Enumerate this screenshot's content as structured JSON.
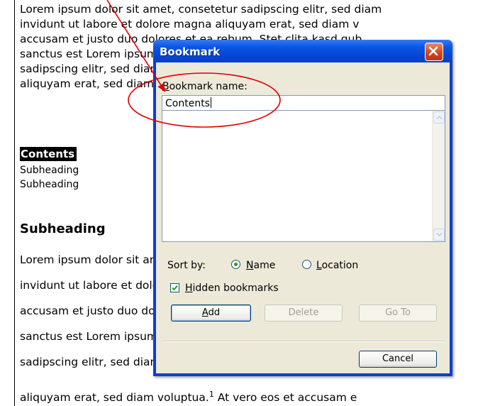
{
  "document": {
    "lines_top": [
      "Lorem ipsum dolor sit amet, consetetur sadipscing elitr, sed diam",
      "invidunt ut labore et dolore magna aliquyam erat, sed diam v",
      "accusam et justo duo dolores et ea rebum. Stet clita kasd gub",
      "sanctus est Lorem ipsum dolor sit amet. Lorem ipsum dolor s",
      "sadipscing elitr, sed diam nonumy eirmod tempor invidunt ut",
      "aliquyam erat, sed diam voluptua."
    ],
    "contents_heading": "Contents",
    "toc_items": [
      "Subheading",
      "Subheading"
    ],
    "subheading": "Subheading",
    "lines_bottom": [
      "Lorem ipsum dolor sit amet, consetetur sadipscing elitr, sed d",
      "invidunt ut labore et dolore magna aliquyam erat, sed diam v",
      "accusam et justo duo dolores et ea rebum. Stet clita kasd gub",
      "sanctus est Lorem ipsum dolor sit amet. Lorem ipsum dolor s",
      "sadipscing elitr, sed diam nonumy eirmod tempor invidunt ut",
      "aliquyam erat, sed diam voluptua."
    ],
    "last_line_rest": " At vero eos et accusam e",
    "footnote_mark": "1"
  },
  "dialog": {
    "title": "Bookmark",
    "name_label_accel": "B",
    "name_label_rest": "ookmark name:",
    "name_value": "Contents",
    "sort_label": "Sort by:",
    "sort_name_accel": "N",
    "sort_name_rest": "ame",
    "sort_location_accel": "L",
    "sort_location_rest": "ocation",
    "sort_selected": "Name",
    "hidden_accel": "H",
    "hidden_rest": "idden bookmarks",
    "hidden_checked": true,
    "add_accel": "A",
    "add_rest": "dd",
    "delete_label": "Delete",
    "goto_label": "Go To",
    "cancel_label": "Cancel"
  },
  "colors": {
    "annotation": "#e00000",
    "titlebar": "#0a50e0",
    "dialog_face": "#ece9d8"
  }
}
